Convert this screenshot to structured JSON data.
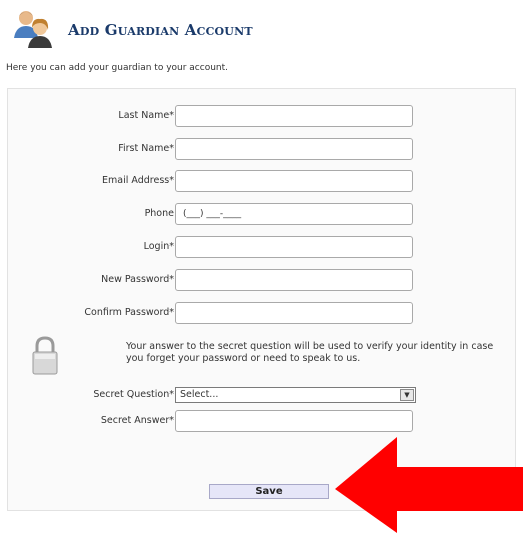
{
  "header": {
    "title": "Add Guardian Account",
    "icon": "users-icon"
  },
  "intro": "Here you can add your guardian to your account.",
  "fields": [
    {
      "label": "Last Name",
      "required": "*",
      "value": ""
    },
    {
      "label": "First Name",
      "required": "*",
      "value": ""
    },
    {
      "label": "Email Address",
      "required": "*",
      "value": ""
    },
    {
      "label": "Phone",
      "required": "",
      "value": "",
      "mask": "(___) ___-____"
    },
    {
      "label": "Login",
      "required": "*",
      "value": ""
    },
    {
      "label": "New Password",
      "required": "*",
      "value": ""
    },
    {
      "label": "Confirm Password",
      "required": "*",
      "value": ""
    }
  ],
  "secret": {
    "note": "Your answer to the secret question will be used to verify your identity in case you forget your password or need to speak to us.",
    "question_label": "Secret Question",
    "question_required": "*",
    "question_value": "Select...",
    "answer_label": "Secret Answer",
    "answer_required": "*",
    "answer_value": "",
    "icon": "lock-icon"
  },
  "save_label": "Save",
  "colors": {
    "title": "#1a3a6a",
    "arrow": "#ff0000",
    "save_bg": "#e6e6f8"
  }
}
